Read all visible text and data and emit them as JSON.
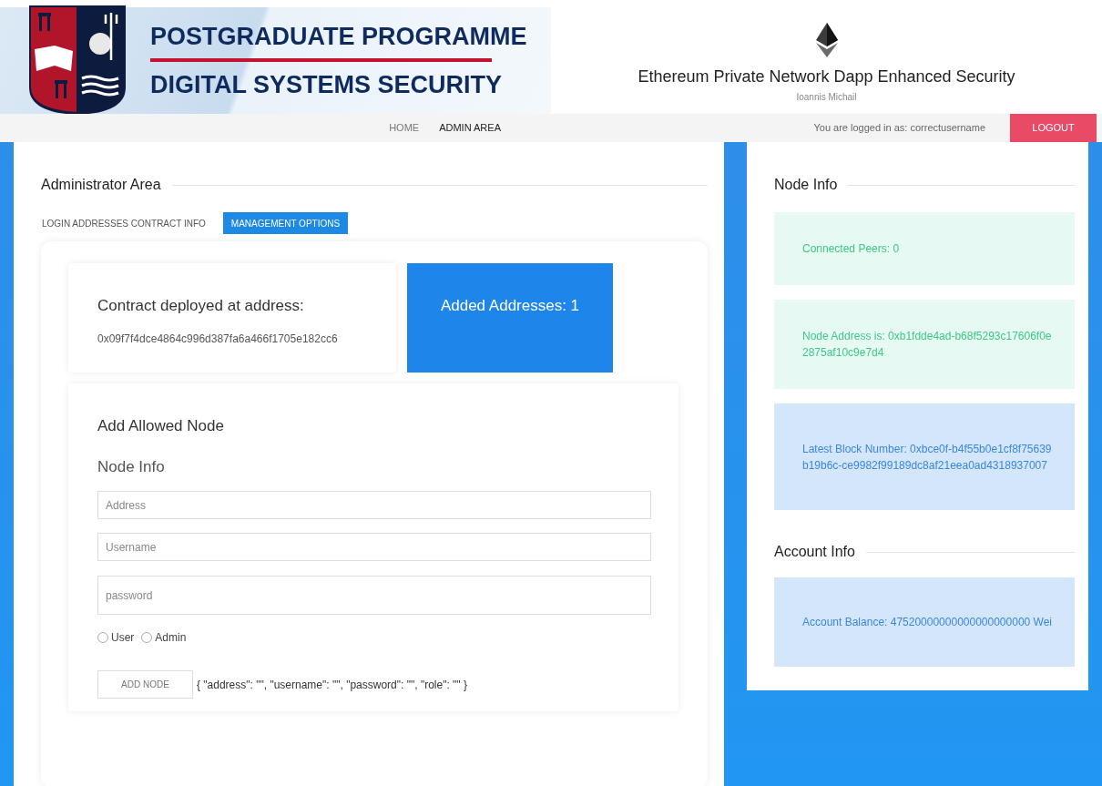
{
  "banner": {
    "line_1": "POSTGRADUATE PROGRAMME",
    "line_2": "DIGITAL SYSTEMS SECURITY"
  },
  "header": {
    "title": "Ethereum Private Network Dapp Enhanced Security",
    "author": "Ioannis Michail"
  },
  "nav": {
    "items": [
      {
        "label": "HOME",
        "selected": false
      },
      {
        "label": "ADMIN AREA",
        "selected": true
      }
    ],
    "login_text": "You are logged in as: correctusername",
    "logout": "LOGOUT"
  },
  "admin": {
    "title": "Administrator Area",
    "tabs": [
      {
        "label": "LOGIN ADDRESSES CONTRACT INFO",
        "selected": false
      },
      {
        "label": "MANAGEMENT OPTIONS",
        "selected": true
      }
    ],
    "contract": {
      "heading": "Contract deployed at address:",
      "address": "0x09f7f4dce4864c996d387fa6a466f1705e182cc6"
    },
    "added": "Added Addresses: 1",
    "form": {
      "title": "Add Allowed Node",
      "subtitle": "Node Info",
      "fields": [
        {
          "placeholder": "Address"
        },
        {
          "placeholder": "Username"
        },
        {
          "placeholder": "password"
        }
      ],
      "roles": [
        {
          "label": "User",
          "checked": false
        },
        {
          "label": "Admin",
          "checked": false
        }
      ],
      "button": "ADD NODE",
      "preview": "{ \"address\": \"\", \"username\": \"\", \"password\": \"\", \"role\": \"\" }"
    }
  },
  "side": {
    "node_title": "Node Info",
    "node_boxes": [
      {
        "text": "Connected Peers: 0",
        "kind": "success"
      },
      {
        "text": "Node Address is: 0xb1fdde4ad-b68f5293c17606f0e2875af10c9e7d4",
        "kind": "success"
      },
      {
        "text": "Latest Block Number: 0xbce0f-b4f55b0e1cf8f75639b19b6c-ce9982f99189dc8af21eea0ad4318937007",
        "kind": "info"
      }
    ],
    "account_title": "Account Info",
    "account_boxes": [
      {
        "text": "Account Balance: 47520000000000000000000 Wei",
        "kind": "info"
      }
    ]
  }
}
